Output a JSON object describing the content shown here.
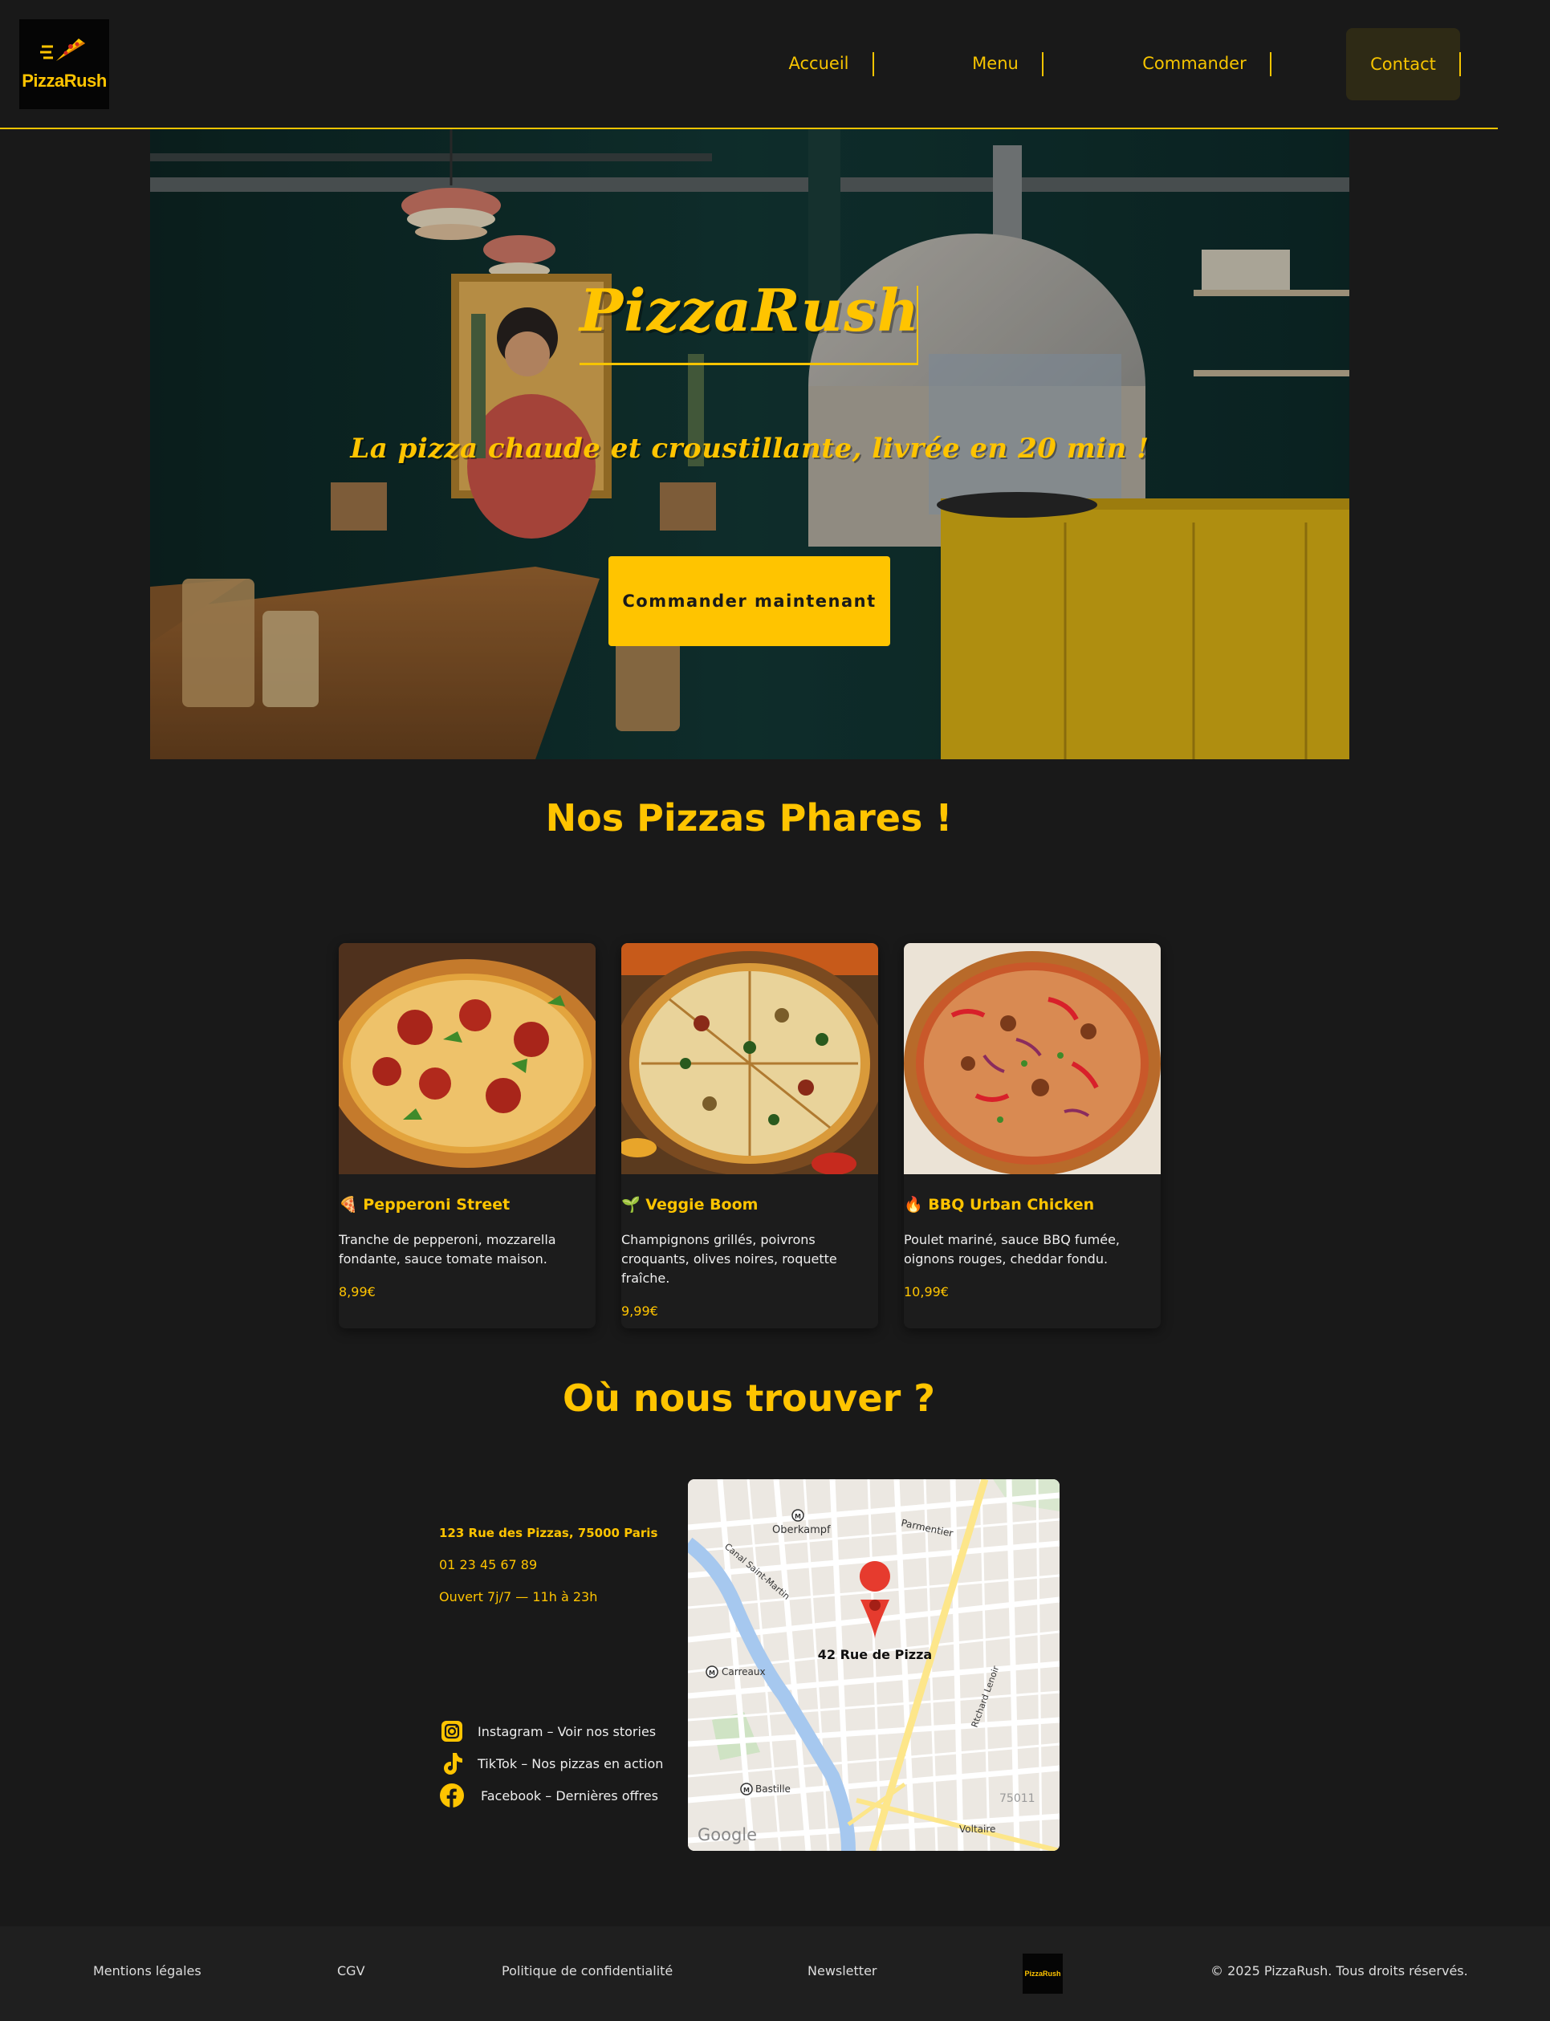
{
  "brand": {
    "name": "PizzaRush",
    "accent": "#ffc400",
    "background": "#191919"
  },
  "nav": {
    "items": [
      {
        "label": "Accueil"
      },
      {
        "label": "Menu"
      },
      {
        "label": "Commander"
      }
    ],
    "contact_label": "Contact"
  },
  "hero": {
    "title": "PizzaRush",
    "subtitle": "La pizza chaude et croustillante, livrée en 20 min !",
    "cta_label": "Commander maintenant"
  },
  "featured": {
    "title": "Nos Pizzas Phares !",
    "cards": [
      {
        "emoji": "🍕",
        "name": "Pepperoni Street",
        "description": "Tranche de pepperoni, mozzarella fondante, sauce tomate maison.",
        "price": "8,99€"
      },
      {
        "emoji": "🌱",
        "name": "Veggie Boom",
        "description": "Champignons grillés, poivrons croquants, olives noires, roquette fraîche.",
        "price": "9,99€"
      },
      {
        "emoji": "🔥",
        "name": "BBQ Urban Chicken",
        "description": "Poulet mariné, sauce BBQ fumée, oignons rouges, cheddar fondu.",
        "price": "10,99€"
      }
    ]
  },
  "location": {
    "title": "Où nous trouver ?",
    "address": "123 Rue des Pizzas, 75000 Paris",
    "phone": "01 23 45 67 89",
    "hours": "Ouvert 7j/7 — 11h à 23h",
    "socials": [
      {
        "icon": "instagram-icon",
        "label": "Instagram – Voir nos stories"
      },
      {
        "icon": "tiktok-icon",
        "label": "TikTok – Nos pizzas en action"
      },
      {
        "icon": "facebook-icon",
        "label": "Facebook – Dernières offres"
      }
    ],
    "map": {
      "pin_label": "42 Rue de Pizza",
      "places": [
        "Oberkampf",
        "Parmentier",
        "Canal Saint-Martin",
        "Carreaux",
        "Bastille",
        "Voltaire",
        "Rtchard Lenoir",
        "75011"
      ],
      "provider": "Google"
    }
  },
  "footer": {
    "links": [
      "Mentions légales",
      "CGV",
      "Politique de confidentialité",
      "Newsletter"
    ],
    "logo_text": "PizzaRush",
    "copyright": "© 2025 PizzaRush. Tous droits réservés."
  }
}
